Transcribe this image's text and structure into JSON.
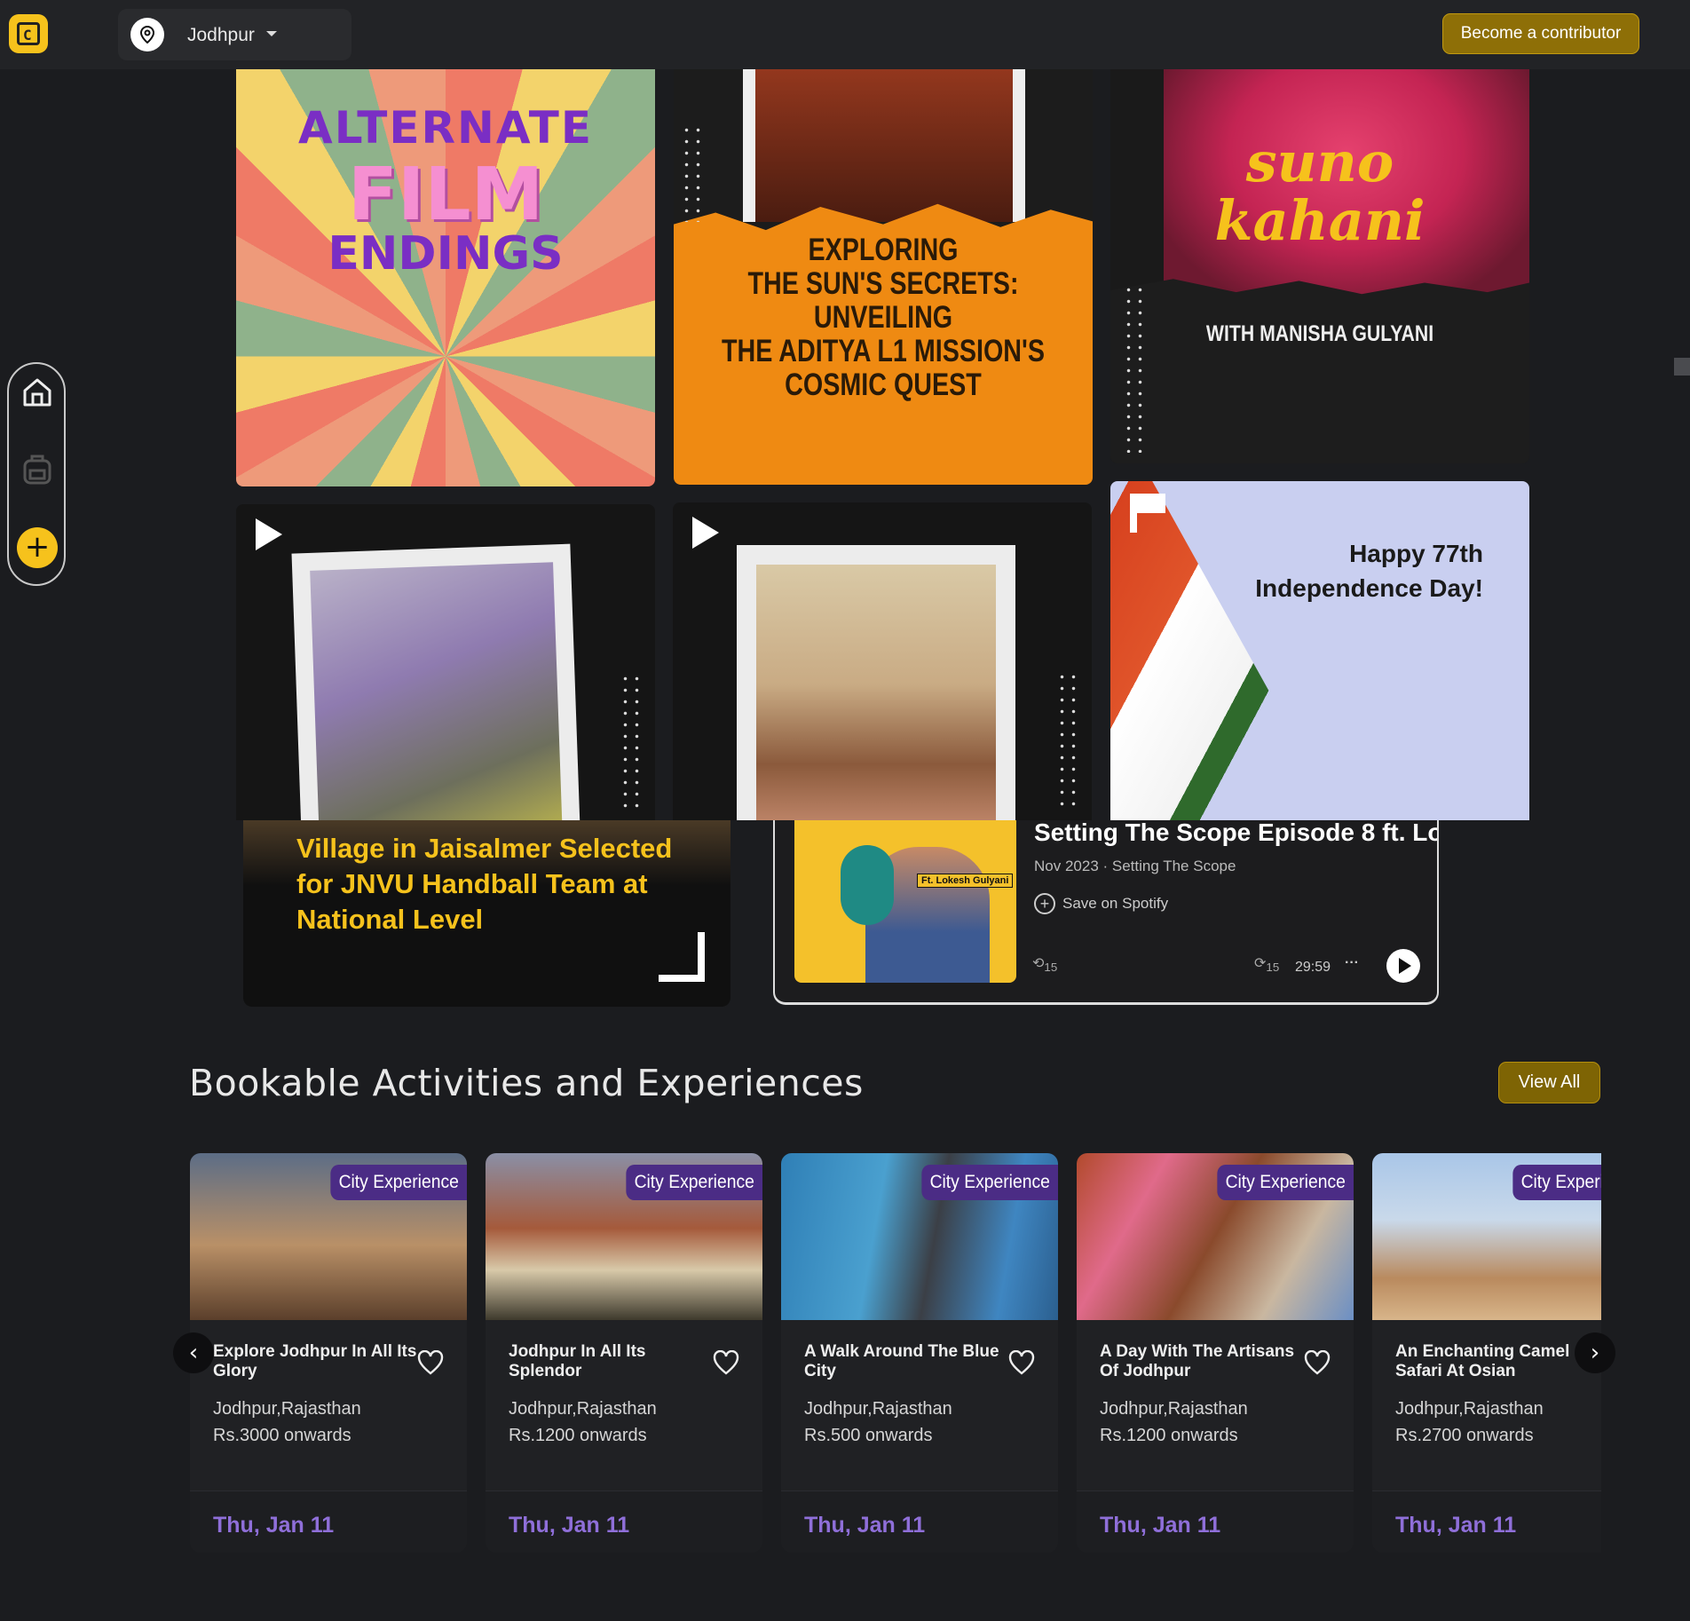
{
  "header": {
    "location": "Jodhpur",
    "contributor_button": "Become a contributor"
  },
  "colors": {
    "accent": "#f6c21c",
    "date_purple": "#8f6fd9",
    "tag_purple": "#4b2c85",
    "background": "#1b1c1f"
  },
  "rail": {
    "icons": [
      "home-icon",
      "backpack-icon",
      "plus-icon"
    ],
    "add_label": "+"
  },
  "videos": [
    {
      "lines": [
        "ALTERNATE",
        "FILM",
        "ENDINGS"
      ]
    },
    {
      "text": "EXPLORING\nTHE SUN'S SECRETS:\nUNVEILING\nTHE ADITYA L1 MISSION'S\nCOSMIC QUEST"
    },
    {
      "title": "suno\nkahani",
      "subtitle": "WITH MANISHA GULYANI"
    },
    {
      "media": "play"
    },
    {
      "media": "play"
    },
    {
      "text": "Happy 77th\nIndependence Day!"
    }
  ],
  "news": {
    "headline": "Village in Jaisalmer Selected for JNVU Handball Team at National Level"
  },
  "spotify": {
    "episode_title": "Setting The Scope Episode 8 ft. Lo",
    "meta": "Nov 2023 · Setting The Scope",
    "save_label": "Save on Spotify",
    "duration": "29:59",
    "art_label": "Ft. Lokesh Gulyani",
    "skip_back": "15",
    "skip_fwd": "15",
    "more": "···"
  },
  "section": {
    "title": "Bookable Activities and Experiences",
    "view_all": "View All"
  },
  "activities": [
    {
      "tag": "City Experience",
      "name": "Explore Jodhpur In All Its Glory",
      "place": "Jodhpur,Rajasthan",
      "price": "Rs.3000 onwards",
      "date": "Thu, Jan 11"
    },
    {
      "tag": "City Experience",
      "name": "Jodhpur In All Its Splendor",
      "place": "Jodhpur,Rajasthan",
      "price": "Rs.1200 onwards",
      "date": "Thu, Jan 11"
    },
    {
      "tag": "City Experience",
      "name": "A Walk Around The Blue City",
      "place": "Jodhpur,Rajasthan",
      "price": "Rs.500 onwards",
      "date": "Thu, Jan 11"
    },
    {
      "tag": "City Experience",
      "name": "A Day With The Artisans Of Jodhpur",
      "place": "Jodhpur,Rajasthan",
      "price": "Rs.1200 onwards",
      "date": "Thu, Jan 11"
    },
    {
      "tag": "City Experience",
      "name": "An Enchanting Camel Safari At Osian",
      "place": "Jodhpur,Rajasthan",
      "price": "Rs.2700 onwards",
      "date": "Thu, Jan 11"
    }
  ],
  "carousel": {
    "prev": "‹",
    "next": "›"
  }
}
